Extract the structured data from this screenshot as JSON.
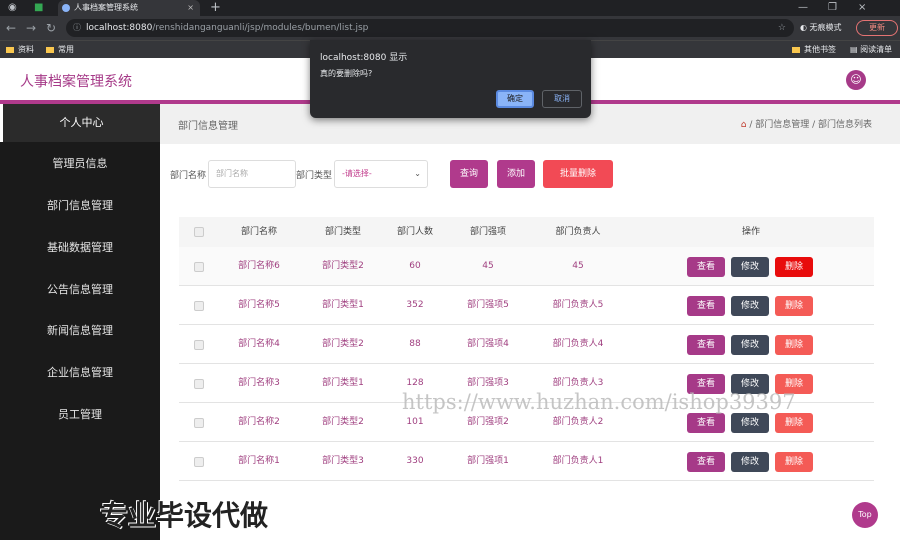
{
  "browser": {
    "tab_title": "人事档案管理系统",
    "new_tab": "+",
    "url_host": "localhost:8080",
    "url_path": "/renshidanganguanli/jsp/modules/bumen/list.jsp",
    "incognito_label": "无痕模式",
    "update_label": "更新",
    "bookmarks": [
      "资料",
      "常用"
    ],
    "bookmarks_right": [
      "其他书签",
      "阅读清单"
    ]
  },
  "dialog": {
    "title": "localhost:8080 显示",
    "message": "真的要删除吗?",
    "ok_label": "确定",
    "cancel_label": "取消"
  },
  "app": {
    "brand": "人事档案管理系统"
  },
  "sidebar": {
    "items": [
      "个人中心",
      "管理员信息",
      "部门信息管理",
      "基础数据管理",
      "公告信息管理",
      "新闻信息管理",
      "企业信息管理",
      "员工管理"
    ]
  },
  "breadcrumb": {
    "title": "部门信息管理",
    "path": "/ 部门信息管理 / 部门信息列表"
  },
  "search": {
    "name_label": "部门名称",
    "name_placeholder": "部门名称",
    "type_label": "部门类型",
    "type_selected": "-请选择-",
    "query_btn": "查询",
    "add_btn": "添加",
    "batch_delete_btn": "批量删除"
  },
  "table": {
    "columns": [
      "部门名称",
      "部门类型",
      "部门人数",
      "部门强项",
      "部门负责人",
      "操作"
    ],
    "rows": [
      [
        "部门名称6",
        "部门类型2",
        "60",
        "45",
        "45"
      ],
      [
        "部门名称5",
        "部门类型1",
        "352",
        "部门强项5",
        "部门负责人5"
      ],
      [
        "部门名称4",
        "部门类型2",
        "88",
        "部门强项4",
        "部门负责人4"
      ],
      [
        "部门名称3",
        "部门类型1",
        "128",
        "部门强项3",
        "部门负责人3"
      ],
      [
        "部门名称2",
        "部门类型2",
        "101",
        "部门强项2",
        "部门负责人2"
      ],
      [
        "部门名称1",
        "部门类型3",
        "330",
        "部门强项1",
        "部门负责人1"
      ]
    ],
    "actions": {
      "view": "查看",
      "edit": "修改",
      "delete": "删除"
    }
  },
  "overlay": {
    "watermark_url": "https://www.huzhan.com/ishop39397",
    "watermark_text": "专业毕设代做",
    "top_btn": "Top"
  }
}
